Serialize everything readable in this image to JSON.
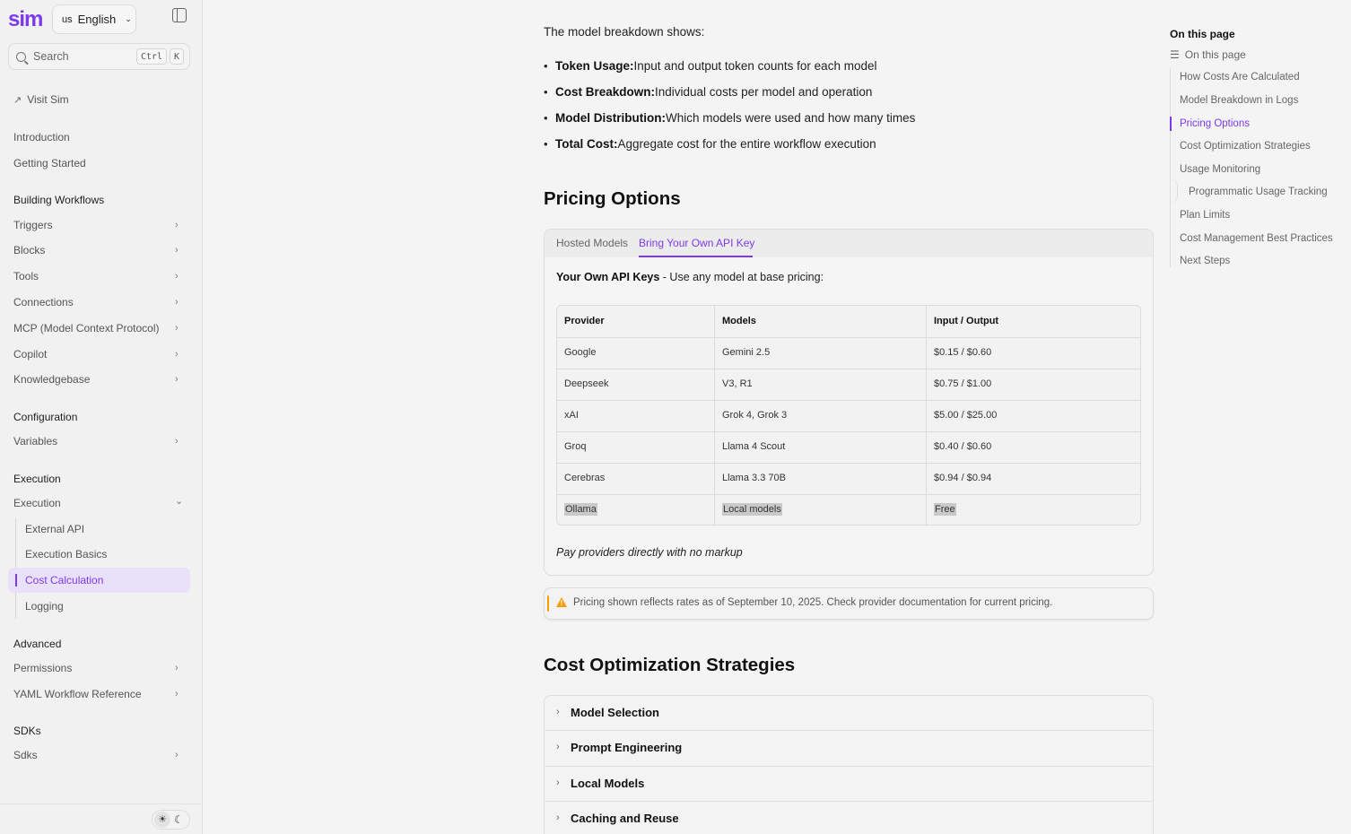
{
  "brand": {
    "logo": "sim",
    "accent": "#7c3aed"
  },
  "language": {
    "flag": "us",
    "label": "English"
  },
  "search": {
    "placeholder": "Search",
    "kbd_ctrl": "Ctrl",
    "kbd_k": "K"
  },
  "sidebar": {
    "visit": "Visit Sim",
    "intro": "Introduction",
    "getting_started": "Getting Started",
    "building_workflows": "Building Workflows",
    "triggers": "Triggers",
    "blocks": "Blocks",
    "tools": "Tools",
    "connections": "Connections",
    "mcp": "MCP (Model Context Protocol)",
    "copilot": "Copilot",
    "knowledgebase": "Knowledgebase",
    "configuration": "Configuration",
    "variables": "Variables",
    "execution_head": "Execution",
    "execution": "Execution",
    "external_api": "External API",
    "execution_basics": "Execution Basics",
    "cost_calculation": "Cost Calculation",
    "logging": "Logging",
    "advanced": "Advanced",
    "permissions": "Permissions",
    "yaml_ref": "YAML Workflow Reference",
    "sdks_head": "SDKs",
    "sdks": "Sdks"
  },
  "main": {
    "breakdown_intro": "The model breakdown shows:",
    "bullets": [
      {
        "term": "Token Usage:",
        "text": " Input and output token counts for each model"
      },
      {
        "term": "Cost Breakdown:",
        "text": " Individual costs per model and operation"
      },
      {
        "term": "Model Distribution:",
        "text": " Which models were used and how many times"
      },
      {
        "term": "Total Cost:",
        "text": " Aggregate cost for the entire workflow execution"
      }
    ],
    "pricing_heading": "Pricing Options",
    "tabs": [
      "Hosted Models",
      "Bring Your Own API Key"
    ],
    "panel_intro_bold": "Your Own API Keys",
    "panel_intro_rest": " - Use any model at base pricing:",
    "table": {
      "headers": [
        "Provider",
        "Models",
        "Input / Output"
      ],
      "rows": [
        [
          "Google",
          "Gemini 2.5",
          "$0.15 / $0.60"
        ],
        [
          "Deepseek",
          "V3, R1",
          "$0.75 / $1.00"
        ],
        [
          "xAI",
          "Grok 4, Grok 3",
          "$5.00 / $25.00"
        ],
        [
          "Groq",
          "Llama 4 Scout",
          "$0.40 / $0.60"
        ],
        [
          "Cerebras",
          "Llama 3.3 70B",
          "$0.94 / $0.94"
        ],
        [
          "Ollama",
          "Local models",
          "Free"
        ]
      ]
    },
    "panel_note": "Pay providers directly with no markup",
    "callout": "Pricing shown reflects rates as of September 10, 2025. Check provider documentation for current pricing.",
    "cost_opt_heading": "Cost Optimization Strategies",
    "accordion": [
      "Model Selection",
      "Prompt Engineering",
      "Local Models",
      "Caching and Reuse"
    ]
  },
  "toc": {
    "title": "On this page",
    "sub": "On this page",
    "items": [
      "How Costs Are Calculated",
      "Model Breakdown in Logs",
      "Pricing Options",
      "Cost Optimization Strategies",
      "Usage Monitoring",
      "Programmatic Usage Tracking",
      "Plan Limits",
      "Cost Management Best Practices",
      "Next Steps"
    ]
  }
}
